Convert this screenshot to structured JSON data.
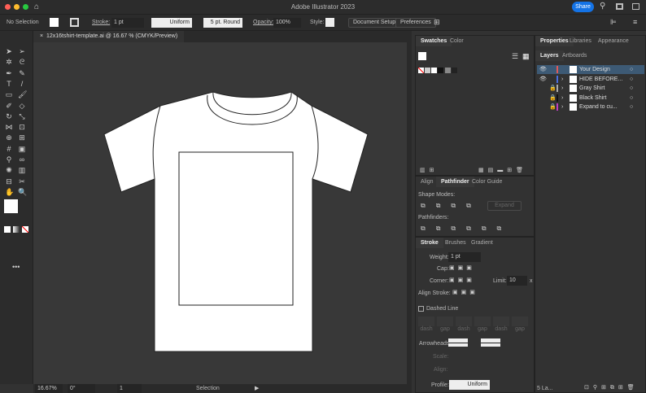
{
  "app_title": "Adobe Illustrator 2023",
  "share_label": "Share",
  "control_bar": {
    "selection": "No Selection",
    "stroke_label": "Stroke:",
    "stroke_weight": "1 pt",
    "profile": "Uniform",
    "brush": "5 pt. Round",
    "opacity_label": "Opacity:",
    "opacity": "100%",
    "style_label": "Style:",
    "document_setup": "Document Setup",
    "preferences": "Preferences"
  },
  "document_tab": "12x16tshirt-template.ai @ 16.67 % (CMYK/Preview)",
  "status_bar": {
    "zoom": "16.67%",
    "rotation": "0°",
    "artboard": "1",
    "tool": "Selection"
  },
  "swatches_panel": {
    "tabs": [
      "Swatches",
      "Color"
    ]
  },
  "pathfinder_panel": {
    "tabs": [
      "Align",
      "Pathfinder",
      "Color Guide"
    ],
    "shape_modes": "Shape Modes:",
    "expand": "Expand",
    "pathfinders": "Pathfinders:"
  },
  "stroke_panel": {
    "tabs": [
      "Stroke",
      "Brushes",
      "Gradient"
    ],
    "weight_label": "Weight:",
    "weight": "1 pt",
    "cap_label": "Cap:",
    "corner_label": "Corner:",
    "limit_label": "Limit:",
    "limit": "10",
    "limit_unit": "x",
    "align_label": "Align Stroke:",
    "dashed": "Dashed Line",
    "dash_labels": [
      "dash",
      "gap",
      "dash",
      "gap",
      "dash",
      "gap"
    ],
    "arrowheads": "Arrowheads:",
    "scale": "Scale:",
    "align": "Align:",
    "profile_label": "Profile:",
    "profile": "Uniform"
  },
  "properties_tabs": [
    "Properties",
    "Libraries",
    "Appearance"
  ],
  "layers_tabs": [
    "Layers",
    "Artboards"
  ],
  "layers": [
    {
      "name": "Your Design",
      "color": "#e05a5a",
      "visible": true,
      "locked": false,
      "selected": true
    },
    {
      "name": "HIDE BEFORE...",
      "color": "#4a6fe0",
      "visible": true,
      "locked": false,
      "selected": false
    },
    {
      "name": "Gray Shirt",
      "color": "#aaaaaa",
      "visible": false,
      "locked": true,
      "selected": false
    },
    {
      "name": "Black Shirt",
      "color": "#111111",
      "visible": false,
      "locked": true,
      "selected": false
    },
    {
      "name": "Expand to cu...",
      "color": "#c040c0",
      "visible": false,
      "locked": true,
      "selected": false
    }
  ],
  "layers_count": "5 La..."
}
